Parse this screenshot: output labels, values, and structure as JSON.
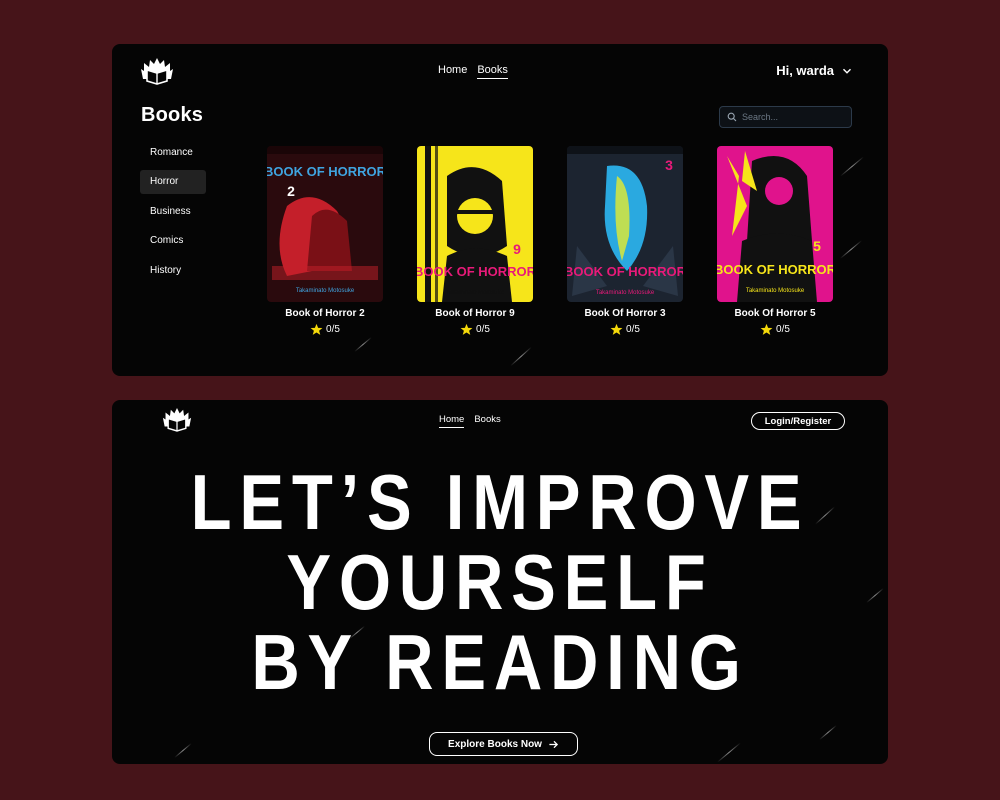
{
  "books_page": {
    "nav": {
      "home": "Home",
      "books": "Books",
      "active": "Books"
    },
    "user_greeting": "Hi, warda",
    "title": "Books",
    "search_placeholder": "Search...",
    "categories": [
      "Romance",
      "Horror",
      "Business",
      "Comics",
      "History"
    ],
    "active_category": "Horror",
    "books": [
      {
        "title": "Book of Horror 2",
        "rating": "0/5",
        "cover_text": "BOOK OF HORROR",
        "number": "2",
        "author": "Takaminato Motosuke",
        "cover_colors": [
          "#2a0a0d",
          "#c41f2a",
          "#3fa4e0"
        ]
      },
      {
        "title": "Book of Horror 9",
        "rating": "0/5",
        "cover_text": "BOOK OF HORROR",
        "number": "9",
        "author": "Takaminato Motosuke",
        "cover_colors": [
          "#f6e51a",
          "#111111",
          "#e81a79"
        ]
      },
      {
        "title": "Book Of Horror 3",
        "rating": "0/5",
        "cover_text": "BOOK OF HORROR",
        "number": "3",
        "author": "Takaminato Motosuke",
        "cover_colors": [
          "#1c2430",
          "#2aa9e0",
          "#e81a79"
        ]
      },
      {
        "title": "Book Of Horror 5",
        "rating": "0/5",
        "cover_text": "BOOK OF HORROR",
        "number": "5",
        "author": "Takaminato Motosuke",
        "cover_colors": [
          "#e0138c",
          "#111111",
          "#f6e51a"
        ]
      }
    ]
  },
  "landing_page": {
    "nav": {
      "home": "Home",
      "books": "Books",
      "active": "Home"
    },
    "login_label": "Login/Register",
    "headline": [
      "LET’S IMPROVE",
      "YOURSELF",
      "BY READING"
    ],
    "cta_label": "Explore Books Now"
  },
  "colors": {
    "background": "#461419",
    "card": "#050505",
    "star": "#f5d90a"
  }
}
